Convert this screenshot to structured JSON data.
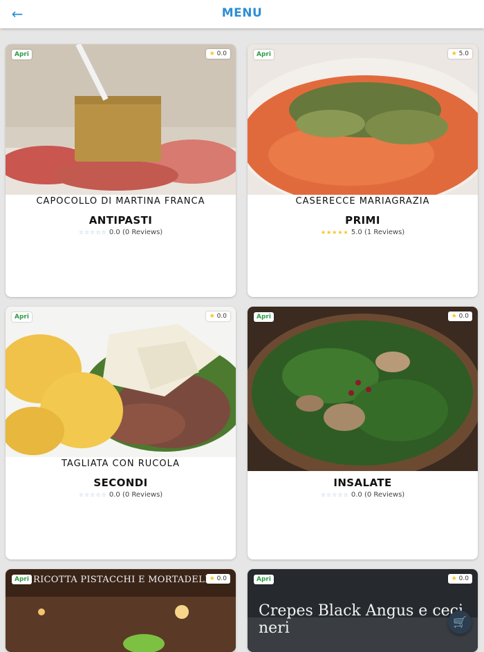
{
  "header": {
    "title": "MENU",
    "back_icon": "arrow-left-icon"
  },
  "cards": [
    {
      "dish": "CAPOCOLLO DI MARTINA FRANCA",
      "category": "ANTIPASTI",
      "open": "Apri",
      "rating_badge": "0.0",
      "stars": 0,
      "rating_text": "0.0 (0 Reviews)"
    },
    {
      "dish": "CASERECCE MARIAGRAZIA",
      "category": "PRIMI",
      "open": "Apri",
      "rating_badge": "5.0",
      "stars": 5,
      "rating_text": "5.0 (1 Reviews)"
    },
    {
      "dish": "TAGLIATA CON RUCOLA",
      "category": "SECONDI",
      "open": "Apri",
      "rating_badge": "0.0",
      "stars": 0,
      "rating_text": "0.0 (0 Reviews)"
    },
    {
      "dish": "",
      "category": "INSALATE",
      "open": "Apri",
      "rating_badge": "0.0",
      "stars": 0,
      "rating_text": "0.0 (0 Reviews)"
    },
    {
      "dish": "RICOTTA PISTACCHI E MORTADELLA",
      "category": "",
      "open": "Apri",
      "rating_badge": "0.0"
    },
    {
      "dish": "Crepes Black Angus e ceci neri",
      "category": "",
      "open": "Apri",
      "rating_badge": "0.0"
    }
  ],
  "cart_icon": "cart-icon",
  "colors": {
    "accent": "#2d8ed6",
    "open_badge": "#2e9b46",
    "star": "#f5c518"
  }
}
